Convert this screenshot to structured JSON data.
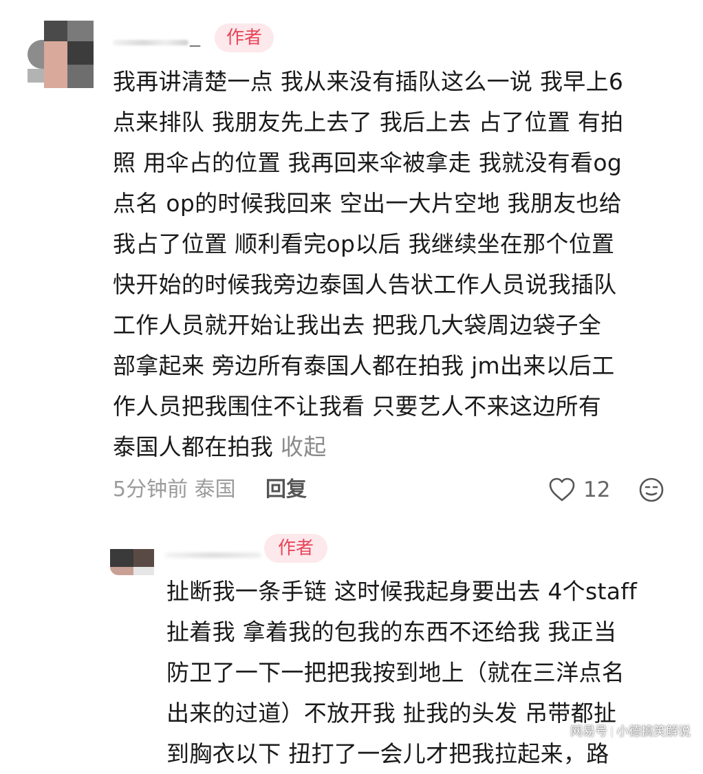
{
  "comments": [
    {
      "username_tail": "_",
      "author_badge": "作者",
      "text": "我再讲清楚一点 我从来没有插队这么一说 我早上6\n点来排队 我朋友先上去了 我后上去 占了位置 有拍\n照 用伞占的位置 我再回来伞被拿走 我就没有看og\n点名 op的时候我回来 空出一大片空地 我朋友也给\n我占了位置 顺利看完op以后 我继续坐在那个位置\n快开始的时候我旁边泰国人告状工作人员说我插队\n工作人员就开始让我出去 把我几大袋周边袋子全\n部拿起来 旁边所有泰国人都在拍我 jm出来以后工\n作人员把我围住不让我看 只要艺人不来这边所有\n泰国人都在拍我",
      "collapse_label": "收起",
      "time_location": "5分钟前 泰国",
      "reply_label": "回复",
      "like_count": "12",
      "like_icon": "heart-outline-icon",
      "emoji_icon": "neutral-face-icon"
    },
    {
      "author_badge": "作者",
      "text": "扯断我一条手链 这时候我起身要出去 4个staff\n扯着我 拿着我的包我的东西不还给我 我正当\n防卫了一下一把把我按到地上（就在三洋点名\n出来的过道）不放开我 扯我的头发 吊带都扯\n到胸衣以下 扭打了一会儿才把我拉起来，路"
    }
  ],
  "watermark": {
    "left": "网易号",
    "right": "小德搞笑解说"
  },
  "colors": {
    "badge_bg": "#fde8eb",
    "badge_text": "#e8455a",
    "body_text": "#1a1a1a",
    "meta_text": "#9b9b9b"
  }
}
